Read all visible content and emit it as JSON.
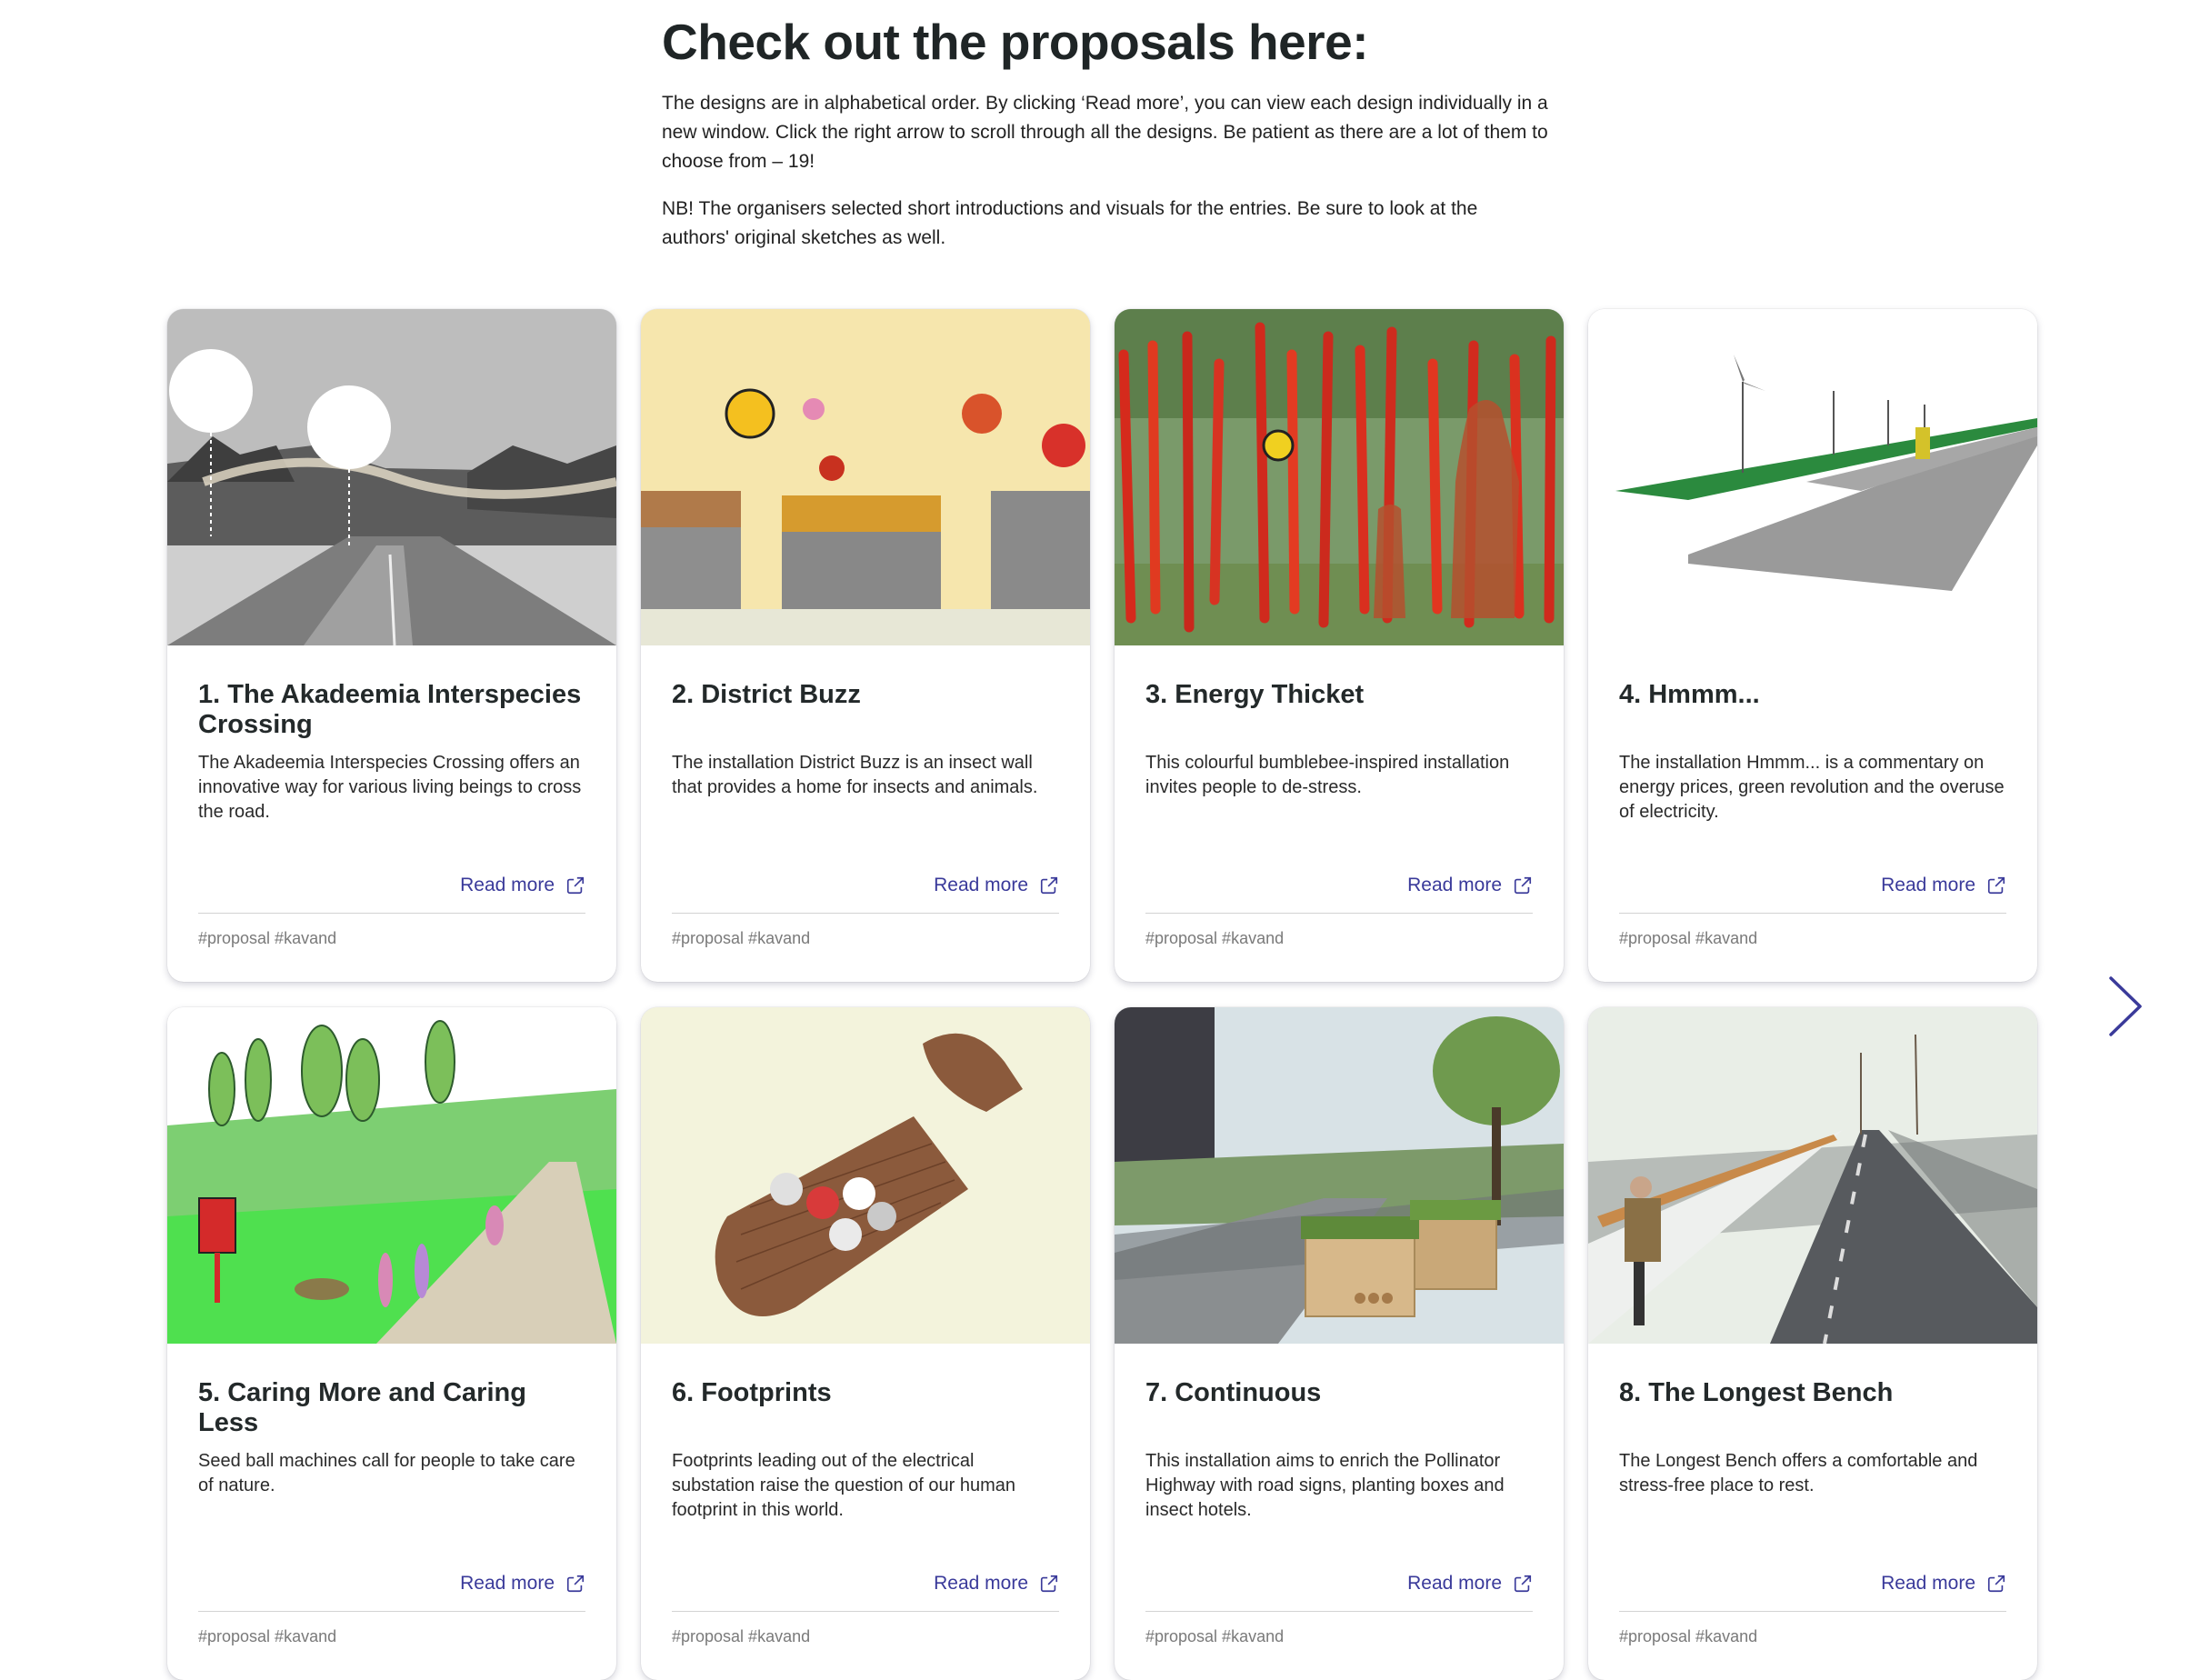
{
  "intro": {
    "heading": "Check out the proposals here:",
    "paragraph1": "The designs are in alphabetical order. By clicking ‘Read more’, you can view each design individually in a new window. Click the right arrow to scroll through all the designs. Be patient as there are a lot of them to choose from – 19!",
    "paragraph2": "NB! The organisers selected short introductions and visuals for the entries. Be sure to look at the authors' original sketches as well."
  },
  "cards": [
    {
      "title": "1. The Akadeemia Interspecies Crossing",
      "desc": "The Akadeemia Interspecies Crossing offers an innovative way for various living beings to cross the road.",
      "read_more": "Read more",
      "tags": "#proposal #kavand"
    },
    {
      "title": "2. District Buzz",
      "desc": "The installation District Buzz is an insect wall that provides a home for insects and animals.",
      "read_more": "Read more",
      "tags": "#proposal #kavand"
    },
    {
      "title": "3. Energy Thicket",
      "desc": "This colourful bumblebee-inspired installation invites people to de-stress.",
      "read_more": "Read more",
      "tags": "#proposal #kavand"
    },
    {
      "title": "4. Hmmm...",
      "desc": "The installation Hmmm... is a commentary on energy prices, green revolution and the overuse of electricity.",
      "read_more": "Read more",
      "tags": "#proposal #kavand"
    },
    {
      "title": "5. Caring More and Caring Less",
      "desc": "Seed ball machines call for people to take care of nature.",
      "read_more": "Read more",
      "tags": "#proposal #kavand"
    },
    {
      "title": "6. Footprints",
      "desc": "Footprints leading out of the electrical substation raise the question of our human footprint in this world.",
      "read_more": "Read more",
      "tags": "#proposal #kavand"
    },
    {
      "title": "7. Continuous",
      "desc": "This installation aims to enrich the Pollinator Highway with road signs, planting boxes and insect hotels.",
      "read_more": "Read more",
      "tags": "#proposal #kavand"
    },
    {
      "title": "8. The Longest Bench",
      "desc": "The Longest Bench offers a comfortable and stress-free place to rest.",
      "read_more": "Read more",
      "tags": "#proposal #kavand"
    }
  ],
  "colors": {
    "link": "#3a3a9a",
    "arrow": "#3a3a9a"
  },
  "icons": {
    "read_more": "external-link-icon",
    "carousel_next": "chevron-right-icon"
  }
}
